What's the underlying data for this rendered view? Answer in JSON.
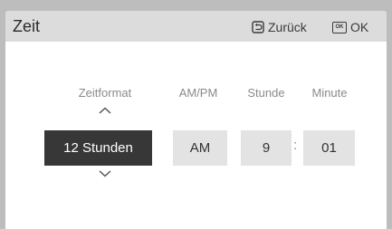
{
  "header": {
    "title": "Zeit",
    "back_label": "Zurück",
    "ok_label": "OK",
    "ok_icon_text": "OK"
  },
  "columns": {
    "time_format": {
      "label": "Zeitformat",
      "value": "12 Stunden"
    },
    "am_pm": {
      "label": "AM/PM",
      "value": "AM"
    },
    "hour": {
      "label": "Stunde",
      "value": "9"
    },
    "minute": {
      "label": "Minute",
      "value": "01"
    }
  },
  "separator": ":",
  "icons": {
    "back": "back-arrow-icon",
    "ok": "ok-key-icon",
    "up": "chevron-up-icon",
    "down": "chevron-down-icon"
  },
  "colors": {
    "selected_background": "#373737",
    "field_background": "#e3e3e3",
    "header_background": "#dcdcdc"
  }
}
